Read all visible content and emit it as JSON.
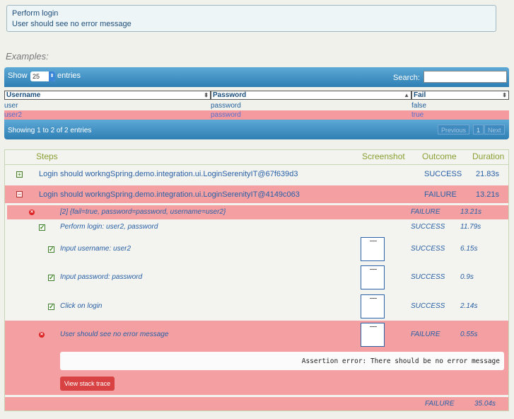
{
  "story": {
    "line1": "Perform login",
    "line2": "User should see no error message"
  },
  "examples": {
    "title": "Examples:",
    "show_label": "Show",
    "entries_value": "25",
    "entries_label": "entries",
    "search_label": "Search:",
    "search_value": "",
    "columns": [
      "Username",
      "Password",
      "Fail"
    ],
    "rows": [
      {
        "username": "user",
        "password": "password",
        "fail": "false"
      },
      {
        "username": "user2",
        "password": "password",
        "fail": "true"
      }
    ],
    "showing_text": "Showing 1 to 2 of 2 entries",
    "pager": {
      "prev": "Previous",
      "page": "1",
      "next": "Next"
    }
  },
  "steps": {
    "headers": {
      "steps": "Steps",
      "screenshot": "Screenshot",
      "outcome": "Outcome",
      "duration": "Duration"
    },
    "test1": {
      "title": "Login should workngSpring.demo.integration.ui.LoginSerenityIT@67f639d3",
      "outcome": "SUCCESS",
      "duration": "21.83s"
    },
    "test2": {
      "title": "Login should workngSpring.demo.integration.ui.LoginSerenityIT@4149c063",
      "outcome": "FAILURE",
      "duration": "13.21s"
    },
    "example": {
      "title": "[2] {fail=true, password=password, username=user2}",
      "outcome": "FAILURE",
      "duration": "13.21s"
    },
    "perform": {
      "title": "Perform login: user2, password",
      "outcome": "SUCCESS",
      "duration": "11.79s"
    },
    "sub": [
      {
        "title": "Input username: user2",
        "outcome": "SUCCESS",
        "duration": "6.15s"
      },
      {
        "title": "Input password: password",
        "outcome": "SUCCESS",
        "duration": "0.9s"
      },
      {
        "title": "Click on login",
        "outcome": "SUCCESS",
        "duration": "2.14s"
      }
    ],
    "no_error": {
      "title": "User should see no error message",
      "outcome": "FAILURE",
      "duration": "0.55s"
    },
    "assertion": "Assertion error: There should be no error message",
    "stack_button": "View stack trace",
    "total": {
      "outcome": "FAILURE",
      "duration": "35.04s"
    }
  }
}
